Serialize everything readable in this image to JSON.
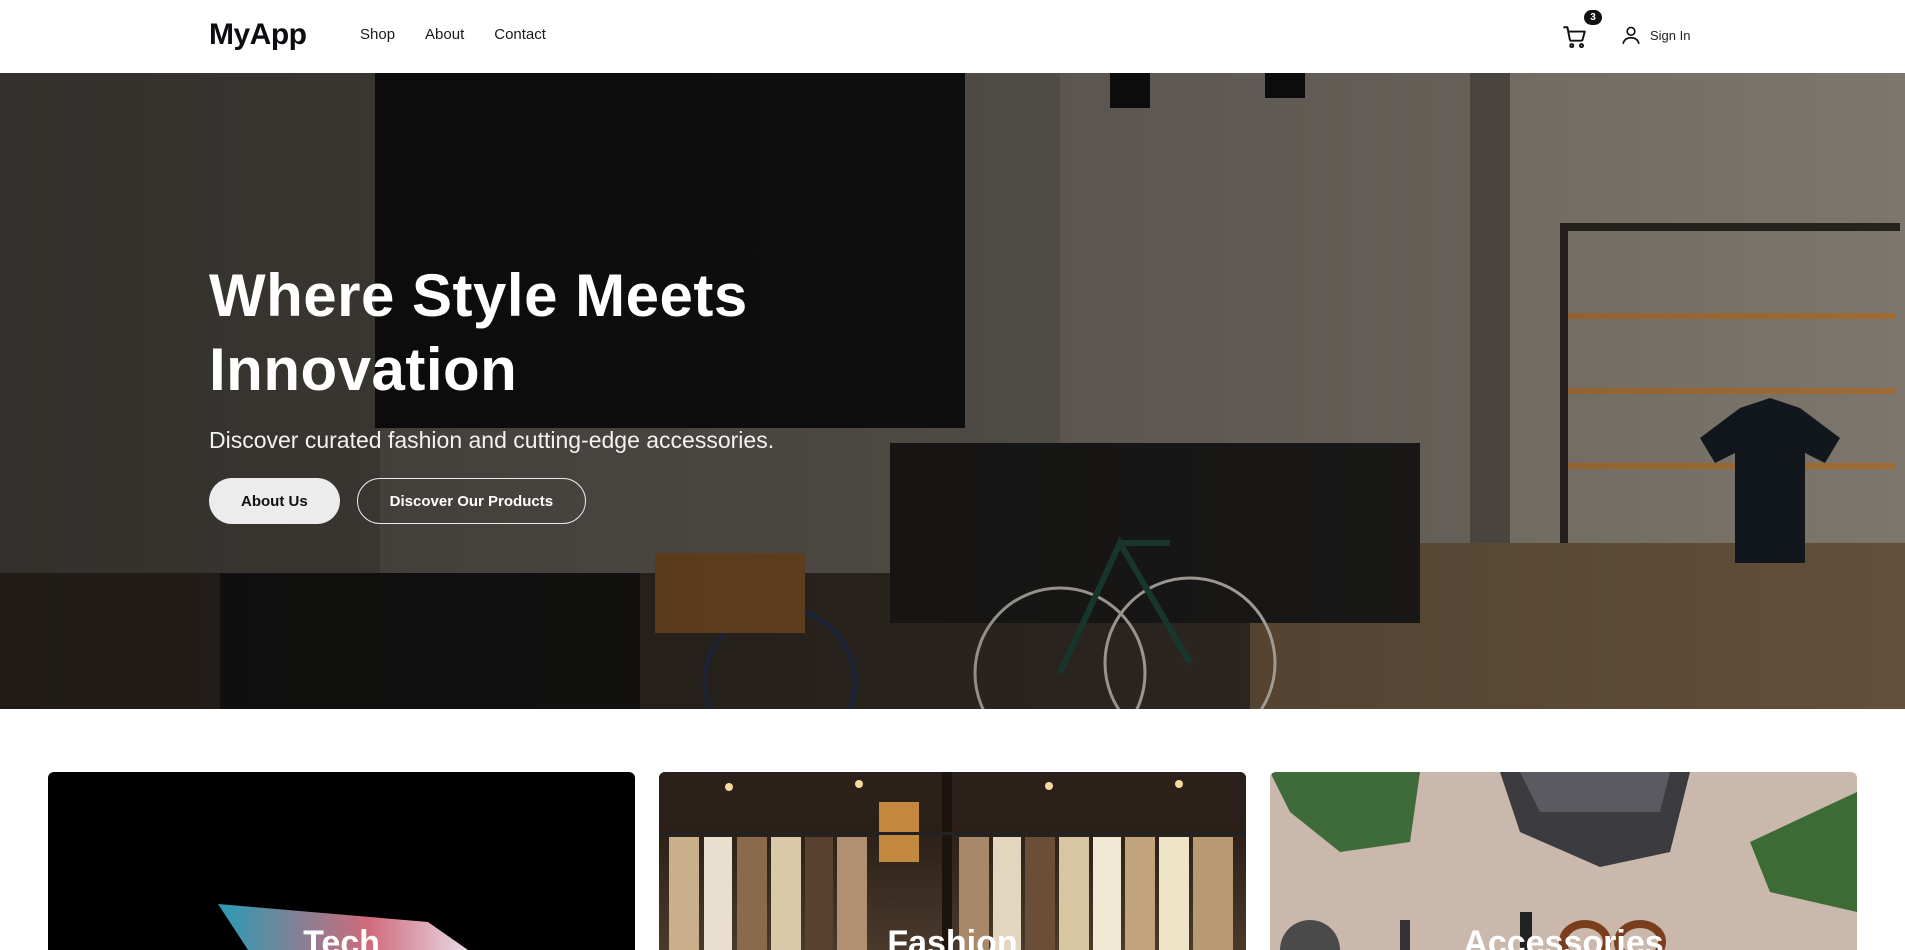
{
  "header": {
    "logo": "MyApp",
    "nav": [
      "Shop",
      "About",
      "Contact"
    ],
    "cart_count": "3",
    "signin_label": "Sign In"
  },
  "hero": {
    "title_line1": "Where Style Meets",
    "title_line2": "Innovation",
    "subtitle": "Discover curated fashion and cutting-edge accessories.",
    "btn_about": "About Us",
    "btn_discover": "Discover Our Products"
  },
  "categories": [
    {
      "label": "Tech"
    },
    {
      "label": "Fashion"
    },
    {
      "label": "Accessories"
    }
  ],
  "colors": {
    "brand": "#0d0d12",
    "badge": "#111111",
    "button_light": "#ececec"
  },
  "icons": {
    "cart": "shopping-cart-icon",
    "user": "user-icon"
  }
}
